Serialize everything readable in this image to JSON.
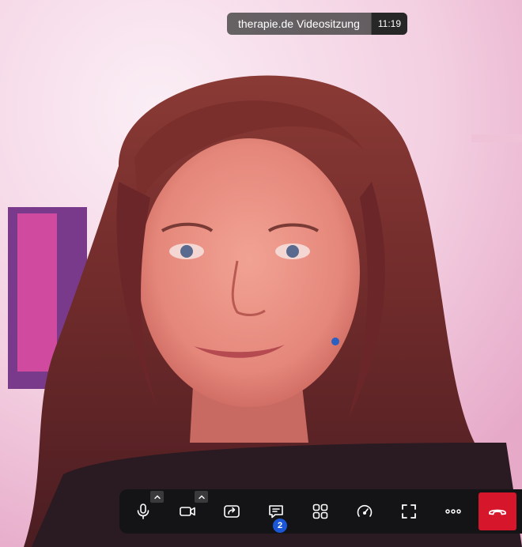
{
  "session": {
    "title": "therapie.de Videositzung",
    "elapsed_time": "11:19"
  },
  "controls": [
    {
      "name": "microphone",
      "icon": "microphone-icon",
      "has_options": true
    },
    {
      "name": "camera",
      "icon": "video-camera-icon",
      "has_options": true
    },
    {
      "name": "share-screen",
      "icon": "share-screen-icon",
      "has_options": false
    },
    {
      "name": "chat",
      "icon": "chat-bubble-icon",
      "has_options": false,
      "badge": "2"
    },
    {
      "name": "layout",
      "icon": "grid-layout-icon",
      "has_options": false
    },
    {
      "name": "connection-quality",
      "icon": "speedometer-icon",
      "has_options": false
    },
    {
      "name": "fullscreen",
      "icon": "fullscreen-icon",
      "has_options": false
    },
    {
      "name": "more",
      "icon": "more-dots-icon",
      "has_options": false
    }
  ],
  "hangup": {
    "icon": "hang-up-icon",
    "color": "#d5162b"
  },
  "colors": {
    "control_bar": "#141416",
    "badge": "#1a56d6",
    "title_pill": "#3c3c3c"
  }
}
